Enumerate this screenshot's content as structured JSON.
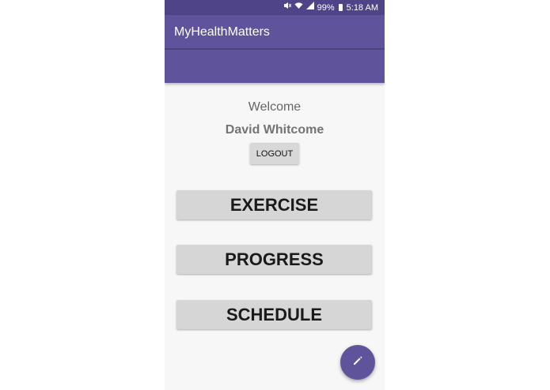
{
  "status_bar": {
    "battery": "99%",
    "time": "5:18 AM",
    "icons": [
      "mute-icon",
      "wifi-icon",
      "signal-icon",
      "battery-icon"
    ]
  },
  "app_bar": {
    "title": "MyHealthMatters"
  },
  "main": {
    "welcome": "Welcome",
    "user_name": "David Whitcome",
    "logout_label": "LOGOUT",
    "buttons": [
      {
        "label": "EXERCISE"
      },
      {
        "label": "PROGRESS"
      },
      {
        "label": "SCHEDULE"
      }
    ]
  },
  "fab": {
    "icon": "pencil-icon"
  },
  "colors": {
    "primary": "#5f549b",
    "primary_dark": "#4f4488",
    "button_bg": "#d6d6d6"
  }
}
